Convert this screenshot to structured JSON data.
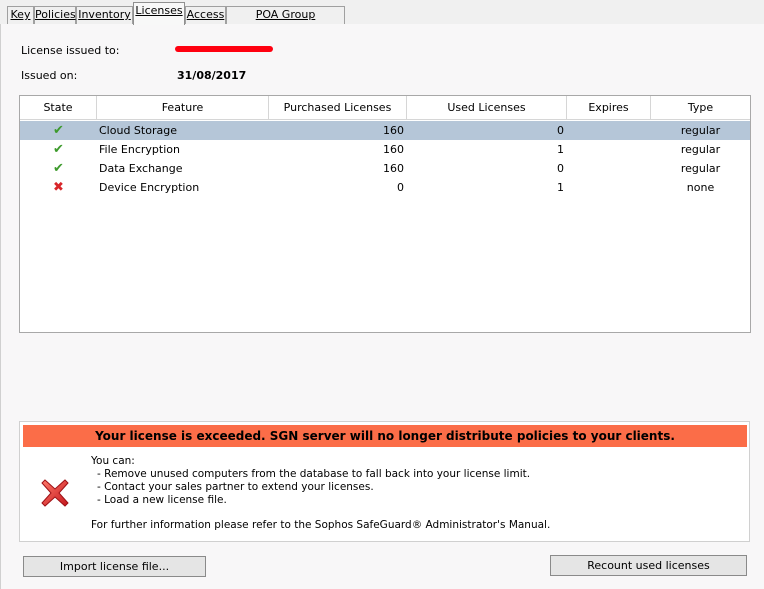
{
  "tabs": [
    {
      "label": "Key",
      "active": false
    },
    {
      "label": "Policies",
      "active": false
    },
    {
      "label": "Inventory",
      "active": false
    },
    {
      "label": "Licenses",
      "active": true
    },
    {
      "label": "Access",
      "active": false
    },
    {
      "label": "POA Group Assignment",
      "active": false
    }
  ],
  "license": {
    "issued_to_label": "License issued to:",
    "issued_on_label": "Issued on:",
    "issued_on_value": "31/08/2017"
  },
  "table": {
    "headers": [
      "State",
      "Feature",
      "Purchased Licenses",
      "Used Licenses",
      "Expires",
      "Type"
    ],
    "rows": [
      {
        "state": "ok",
        "feature": "Cloud Storage",
        "purchased": "160",
        "used": "0",
        "expires": "",
        "type": "regular",
        "selected": true
      },
      {
        "state": "ok",
        "feature": "File Encryption",
        "purchased": "160",
        "used": "1",
        "expires": "",
        "type": "regular",
        "selected": false
      },
      {
        "state": "ok",
        "feature": "Data Exchange",
        "purchased": "160",
        "used": "0",
        "expires": "",
        "type": "regular",
        "selected": false
      },
      {
        "state": "error",
        "feature": "Device Encryption",
        "purchased": "0",
        "used": "1",
        "expires": "",
        "type": "none",
        "selected": false
      }
    ]
  },
  "warning": {
    "banner": "Your license is exceeded. SGN server will no longer distribute policies to your clients.",
    "intro": "You can:",
    "items": [
      "- Remove unused computers from the database to fall back into your license limit.",
      "- Contact your sales partner to extend your licenses.",
      "- Load a new license file."
    ],
    "footer": "For further information please refer to the Sophos SafeGuard® Administrator's Manual.",
    "banner_color": "#fb6d48"
  },
  "buttons": {
    "import": "Import license file...",
    "recount": "Recount used licenses"
  },
  "icons": {
    "ok": "check-icon",
    "error": "cross-icon"
  }
}
